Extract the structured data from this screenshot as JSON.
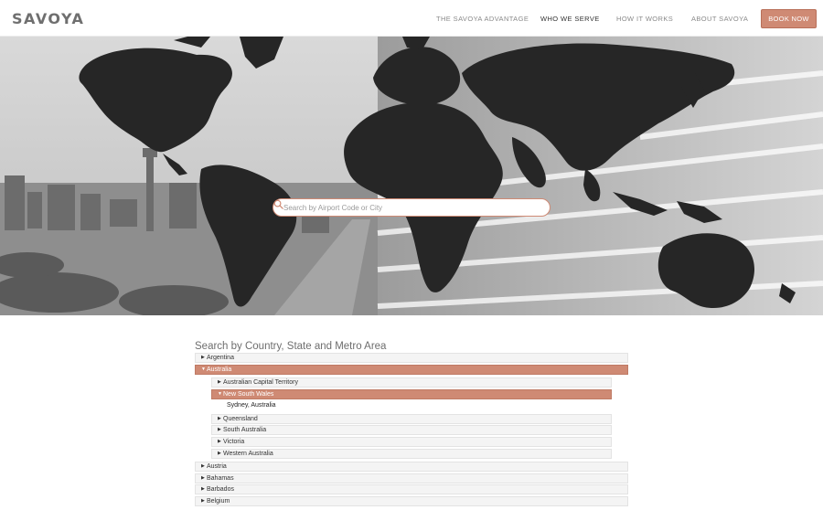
{
  "brand": {
    "logo": "SAVOYA"
  },
  "nav": {
    "items": [
      {
        "label": "THE SAVOYA ADVANTAGE"
      },
      {
        "label": "WHO WE SERVE"
      },
      {
        "label": "HOW IT WORKS"
      },
      {
        "label": "ABOUT SAVOYA"
      }
    ],
    "active_index": 1,
    "book_label": "BOOK NOW"
  },
  "hero": {
    "search_placeholder": "Search by Airport Code or City"
  },
  "tree": {
    "title": "Search by Country, State and Metro Area",
    "countries_top": [
      {
        "label": "Argentina"
      },
      {
        "label": "Australia",
        "expanded": true
      }
    ],
    "australia_regions": [
      {
        "label": "Australian Capital Territory"
      },
      {
        "label": "New South Wales",
        "expanded": true
      },
      {
        "label": "Queensland"
      },
      {
        "label": "South Australia"
      },
      {
        "label": "Victoria"
      },
      {
        "label": "Western Australia"
      }
    ],
    "nsw_metros": [
      {
        "label": "Sydney, Australia"
      }
    ],
    "countries_bottom": [
      {
        "label": "Austria"
      },
      {
        "label": "Bahamas"
      },
      {
        "label": "Barbados"
      },
      {
        "label": "Belgium"
      }
    ]
  },
  "colors": {
    "accent": "#cf8a74",
    "accent_border": "#b86f59",
    "text_muted": "#8a8a8a"
  },
  "icons": {
    "search": "search-icon",
    "collapsed": "caret-right-icon",
    "expanded": "caret-down-icon"
  }
}
